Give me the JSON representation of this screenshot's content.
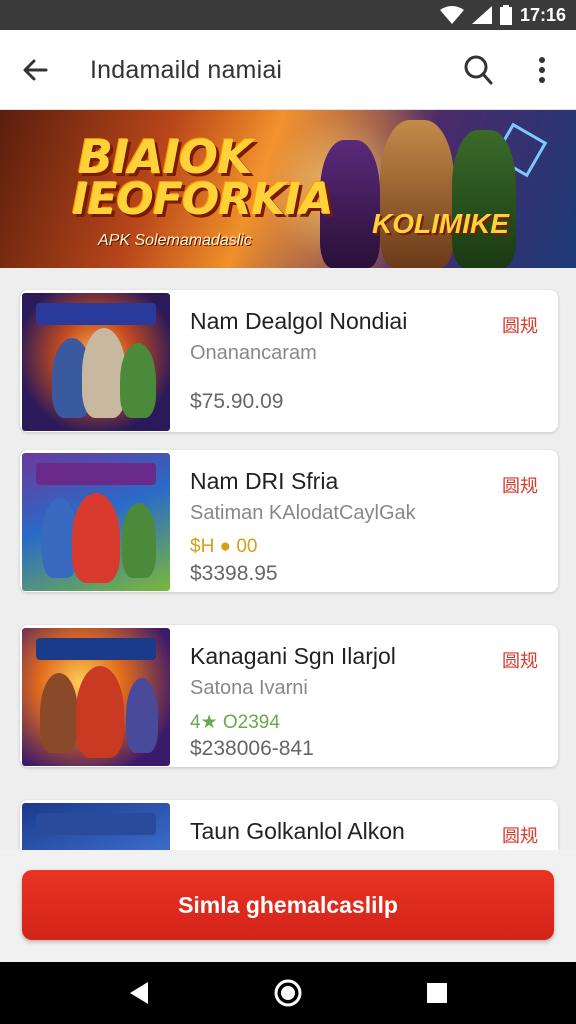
{
  "status_bar": {
    "time": "17:16"
  },
  "app_bar": {
    "title": "Indamaild namiai"
  },
  "banner": {
    "headline_line1": "BIAIOK",
    "headline_line2": "IEOFORKIA",
    "subline": "APK Solemamadaslic",
    "tag": "KOLIMIKE"
  },
  "games": [
    {
      "name": "Nam Dealgol Nondiai",
      "subtitle": "Onanancaram",
      "rating": "",
      "price": "$75.90.09",
      "badge": "圆规"
    },
    {
      "name": "Nam DRI Sfria",
      "subtitle": "Satiman KAlodatCaylGak",
      "rating": "$H  ● 00",
      "price": "$3398.95",
      "badge": "圆规"
    },
    {
      "name": "Kanagani Sgn Ilarjol",
      "subtitle": "Satona Ivarni",
      "rating": "4★ O2394",
      "price": "$238006-841",
      "badge": "圆规"
    },
    {
      "name": "Taun Golkanlol Alkon",
      "subtitle": "",
      "rating": "",
      "price": "",
      "badge": "圆规"
    }
  ],
  "cta": {
    "label": "Simla ghemalcaslilp"
  },
  "colors": {
    "accent": "#d83a2e",
    "cta": "#e02a1e",
    "rating_gold": "#d4a017",
    "rating_green": "#6aa84f"
  },
  "icons": [
    "back-arrow-icon",
    "search-icon",
    "more-vert-icon",
    "wifi-icon",
    "signal-icon",
    "battery-icon",
    "nav-back-icon",
    "nav-home-icon",
    "nav-recents-icon"
  ]
}
